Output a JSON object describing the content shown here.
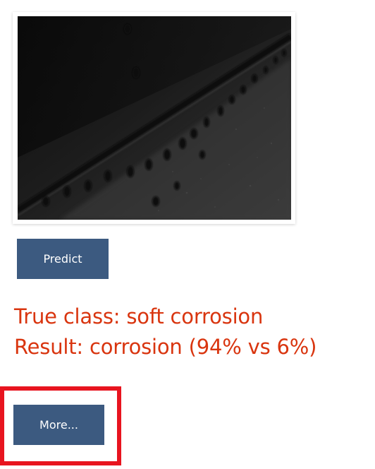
{
  "image": {
    "alt": "corroded riveted metal panel photo"
  },
  "buttons": {
    "predict_label": "Predict",
    "more_label": "More..."
  },
  "result": {
    "true_class_line": "True class: soft corrosion",
    "result_line": "Result: corrosion (94% vs 6%)"
  },
  "colors": {
    "button_bg": "#3c5a80",
    "result_text": "#d9350f",
    "highlight_border": "#e8141f"
  }
}
